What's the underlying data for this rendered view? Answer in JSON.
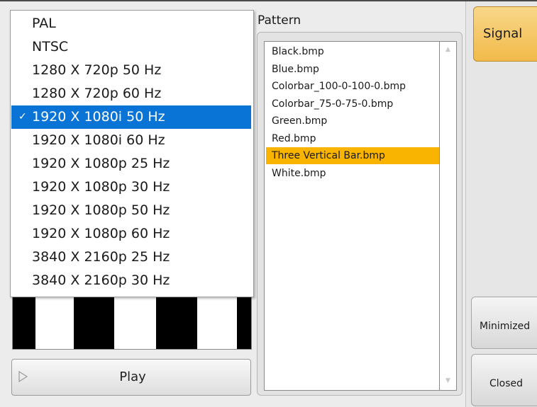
{
  "resolution_menu": {
    "items": [
      {
        "label": "PAL",
        "selected": false
      },
      {
        "label": "NTSC",
        "selected": false
      },
      {
        "label": "1280 X 720p 50 Hz",
        "selected": false
      },
      {
        "label": "1280 X 720p 60 Hz",
        "selected": false
      },
      {
        "label": "1920 X 1080i 50 Hz",
        "selected": true
      },
      {
        "label": "1920 X 1080i 60 Hz",
        "selected": false
      },
      {
        "label": "1920 X 1080p 25 Hz",
        "selected": false
      },
      {
        "label": "1920 X 1080p 30 Hz",
        "selected": false
      },
      {
        "label": "1920 X 1080p 50 Hz",
        "selected": false
      },
      {
        "label": "1920 X 1080p 60 Hz",
        "selected": false
      },
      {
        "label": "3840 X 2160p 25 Hz",
        "selected": false
      },
      {
        "label": "3840 X 2160p 30 Hz",
        "selected": false
      }
    ],
    "check_mark": "✓"
  },
  "pattern": {
    "label": "Pattern",
    "files": [
      {
        "name": "Black.bmp",
        "highlighted": false
      },
      {
        "name": "Blue.bmp",
        "highlighted": false
      },
      {
        "name": "Colorbar_100-0-100-0.bmp",
        "highlighted": false
      },
      {
        "name": "Colorbar_75-0-75-0.bmp",
        "highlighted": false
      },
      {
        "name": "Green.bmp",
        "highlighted": false
      },
      {
        "name": "Red.bmp",
        "highlighted": false
      },
      {
        "name": "Three Vertical Bar.bmp",
        "highlighted": true
      },
      {
        "name": "White.bmp",
        "highlighted": false
      }
    ]
  },
  "preview": {
    "pattern_colors": [
      "#000000",
      "#ffffff"
    ]
  },
  "play_button": {
    "label": "Play",
    "icon": "play-triangle-icon"
  },
  "right_buttons": {
    "signal": "Signal",
    "minimized": "Minimized",
    "closed": "Closed"
  },
  "colors": {
    "menu_selection": "#0a74d6",
    "pattern_highlight": "#f8b400",
    "signal_button": "#f2ba4a"
  }
}
